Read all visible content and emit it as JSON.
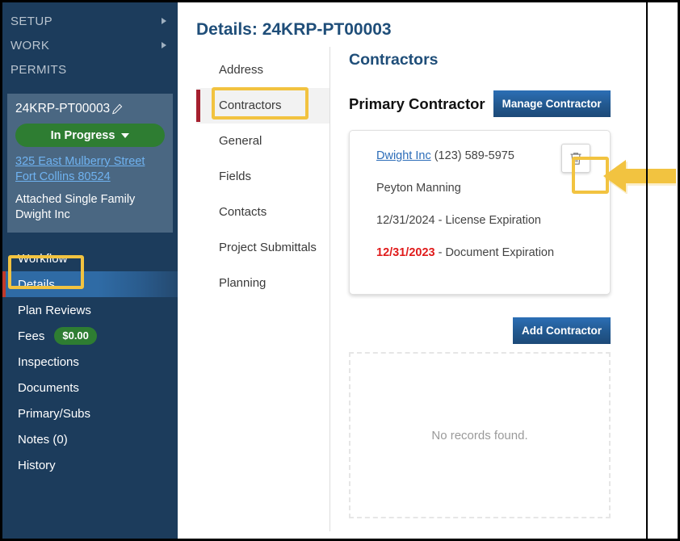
{
  "left_nav": {
    "top_items": [
      {
        "label": "SETUP",
        "icon": "chevron-right-icon",
        "has_caret": true
      },
      {
        "label": "WORK",
        "icon": "chevron-right-icon",
        "has_caret": true
      },
      {
        "label": "PERMITS",
        "has_caret": false
      }
    ],
    "record": {
      "id": "24KRP-PT00003",
      "edit_icon": "pencil-icon",
      "status": "In Progress",
      "status_color": "#2e7d32",
      "status_caret_icon": "caret-down-icon",
      "address": "325 East Mulberry Street Fort Collins 80524",
      "type": "Attached Single Family",
      "contractor": "Dwight Inc"
    },
    "menu": [
      {
        "label": "Workflow",
        "active": false
      },
      {
        "label": "Details",
        "active": true
      },
      {
        "label": "Plan Reviews",
        "active": false
      },
      {
        "label": "Fees",
        "active": false,
        "badge": "$0.00",
        "badge_color": "#2e7d32"
      },
      {
        "label": "Inspections",
        "active": false
      },
      {
        "label": "Documents",
        "active": false
      },
      {
        "label": "Primary/Subs",
        "active": false
      },
      {
        "label": "Notes  (0)",
        "active": false
      },
      {
        "label": "History",
        "active": false
      }
    ]
  },
  "main": {
    "page_title": "Details: 24KRP-PT00003",
    "tabs": [
      {
        "label": "Address",
        "active": false
      },
      {
        "label": "Contractors",
        "active": true
      },
      {
        "label": "General",
        "active": false
      },
      {
        "label": "Fields",
        "active": false
      },
      {
        "label": "Contacts",
        "active": false
      },
      {
        "label": "Project Submittals",
        "active": false
      },
      {
        "label": "Planning",
        "active": false
      }
    ],
    "pane": {
      "title": "Contractors",
      "primary_label": "Primary Contractor",
      "manage_button": "Manage Contractor",
      "card": {
        "company_link": "Dwight Inc",
        "phone": " (123) 589-5975",
        "contact_name": "Peyton Manning",
        "license_date": "12/31/2024",
        "license_label": " - License Expiration",
        "document_date": "12/31/2023",
        "document_label": " - Document Expiration",
        "document_alert_color": "#e01b1b",
        "delete_icon": "trash-icon"
      },
      "add_button": "Add Contractor",
      "empty_state": "No records found."
    }
  },
  "annotations": {
    "highlight_color": "#f2c340",
    "boxes": [
      {
        "target": "details-sidebar-item"
      },
      {
        "target": "contractors-tab"
      },
      {
        "target": "delete-contractor-button"
      }
    ],
    "arrow": {
      "direction": "left",
      "points_to": "delete-contractor-button"
    }
  }
}
